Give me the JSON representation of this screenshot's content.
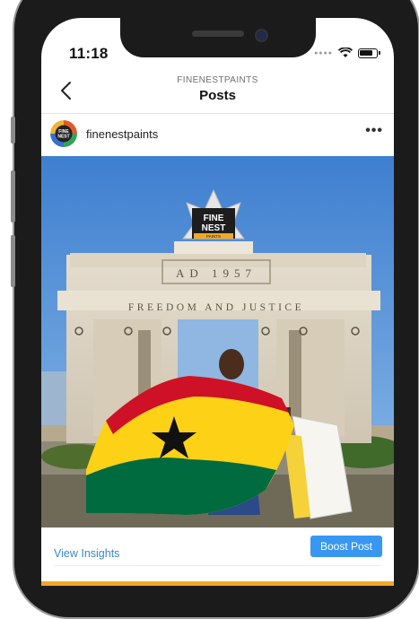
{
  "status_bar": {
    "time": "11:18"
  },
  "header": {
    "account_handle": "FINENESTPAINTS",
    "title": "Posts"
  },
  "post": {
    "account_name": "finenestpaints",
    "more_label": "•••",
    "photo": {
      "monument_top_text": "AD 1957",
      "monument_band_text": "FREEDOM AND JUSTICE",
      "logo_text_line1": "FINE",
      "logo_text_line2": "NEST",
      "logo_text_small": "PAINTS"
    }
  },
  "actions": {
    "insights_label": "View Insights",
    "boost_label": "Boost Post"
  },
  "colors": {
    "accent": "#3897f0",
    "link": "#3a87c9",
    "ghana_red": "#ce1126",
    "ghana_gold": "#fcd116",
    "ghana_green": "#006b3f"
  }
}
